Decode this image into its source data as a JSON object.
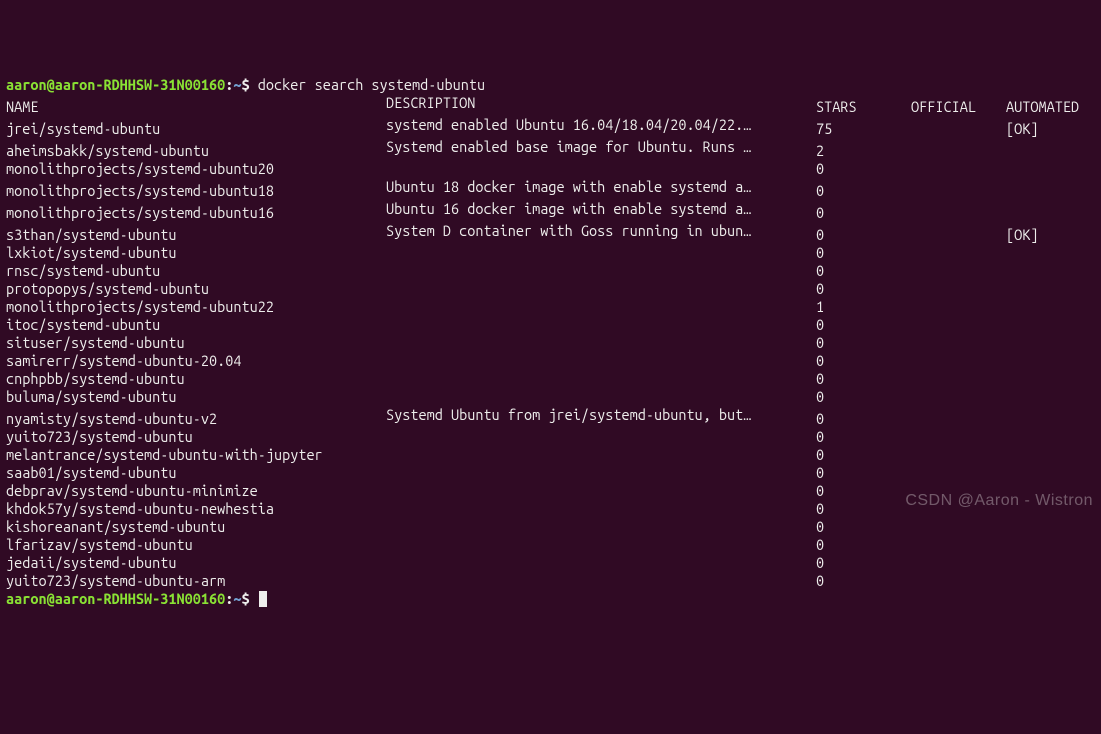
{
  "prompt": {
    "user_host": "aaron@aaron-RDHHSW-31N00160",
    "sep": ":",
    "path": "~",
    "dollar": "$"
  },
  "command": "docker search systemd-ubuntu",
  "headers": {
    "name": "NAME",
    "description": "DESCRIPTION",
    "stars": "STARS",
    "official": "OFFICIAL",
    "automated": "AUTOMATED"
  },
  "rows": [
    {
      "name": "jrei/systemd-ubuntu",
      "description": "systemd enabled Ubuntu 16.04/18.04/20.04/22.…",
      "stars": "75",
      "official": "",
      "automated": "[OK]"
    },
    {
      "name": "aheimsbakk/systemd-ubuntu",
      "description": "Systemd enabled base image for Ubuntu. Runs …",
      "stars": "2",
      "official": "",
      "automated": ""
    },
    {
      "name": "monolithprojects/systemd-ubuntu20",
      "description": "",
      "stars": "0",
      "official": "",
      "automated": ""
    },
    {
      "name": "monolithprojects/systemd-ubuntu18",
      "description": "Ubuntu 18 docker image with enable systemd a…",
      "stars": "0",
      "official": "",
      "automated": ""
    },
    {
      "name": "monolithprojects/systemd-ubuntu16",
      "description": "Ubuntu 16 docker image with enable systemd a…",
      "stars": "0",
      "official": "",
      "automated": ""
    },
    {
      "name": "s3than/systemd-ubuntu",
      "description": "System D container with Goss running in ubun…",
      "stars": "0",
      "official": "",
      "automated": "[OK]"
    },
    {
      "name": "lxkiot/systemd-ubuntu",
      "description": "",
      "stars": "0",
      "official": "",
      "automated": ""
    },
    {
      "name": "rnsc/systemd-ubuntu",
      "description": "",
      "stars": "0",
      "official": "",
      "automated": ""
    },
    {
      "name": "protopopys/systemd-ubuntu",
      "description": "",
      "stars": "0",
      "official": "",
      "automated": ""
    },
    {
      "name": "monolithprojects/systemd-ubuntu22",
      "description": "",
      "stars": "1",
      "official": "",
      "automated": ""
    },
    {
      "name": "itoc/systemd-ubuntu",
      "description": "",
      "stars": "0",
      "official": "",
      "automated": ""
    },
    {
      "name": "situser/systemd-ubuntu",
      "description": "",
      "stars": "0",
      "official": "",
      "automated": ""
    },
    {
      "name": "samirerr/systemd-ubuntu-20.04",
      "description": "",
      "stars": "0",
      "official": "",
      "automated": ""
    },
    {
      "name": "cnphpbb/systemd-ubuntu",
      "description": "",
      "stars": "0",
      "official": "",
      "automated": ""
    },
    {
      "name": "buluma/systemd-ubuntu",
      "description": "",
      "stars": "0",
      "official": "",
      "automated": ""
    },
    {
      "name": "nyamisty/systemd-ubuntu-v2",
      "description": "Systemd Ubuntu from jrei/systemd-ubuntu, but…",
      "stars": "0",
      "official": "",
      "automated": ""
    },
    {
      "name": "yuito723/systemd-ubuntu",
      "description": "",
      "stars": "0",
      "official": "",
      "automated": ""
    },
    {
      "name": "melantrance/systemd-ubuntu-with-jupyter",
      "description": "",
      "stars": "0",
      "official": "",
      "automated": ""
    },
    {
      "name": "saab01/systemd-ubuntu",
      "description": "",
      "stars": "0",
      "official": "",
      "automated": ""
    },
    {
      "name": "debprav/systemd-ubuntu-minimize",
      "description": "",
      "stars": "0",
      "official": "",
      "automated": ""
    },
    {
      "name": "khdok57y/systemd-ubuntu-newhestia",
      "description": "",
      "stars": "0",
      "official": "",
      "automated": ""
    },
    {
      "name": "kishoreanant/systemd-ubuntu",
      "description": "",
      "stars": "0",
      "official": "",
      "automated": ""
    },
    {
      "name": "lfarizav/systemd-ubuntu",
      "description": "",
      "stars": "0",
      "official": "",
      "automated": ""
    },
    {
      "name": "jedaii/systemd-ubuntu",
      "description": "",
      "stars": "0",
      "official": "",
      "automated": ""
    },
    {
      "name": "yuito723/systemd-ubuntu-arm",
      "description": "",
      "stars": "0",
      "official": "",
      "automated": ""
    }
  ],
  "watermark": "CSDN @Aaron - Wistron"
}
